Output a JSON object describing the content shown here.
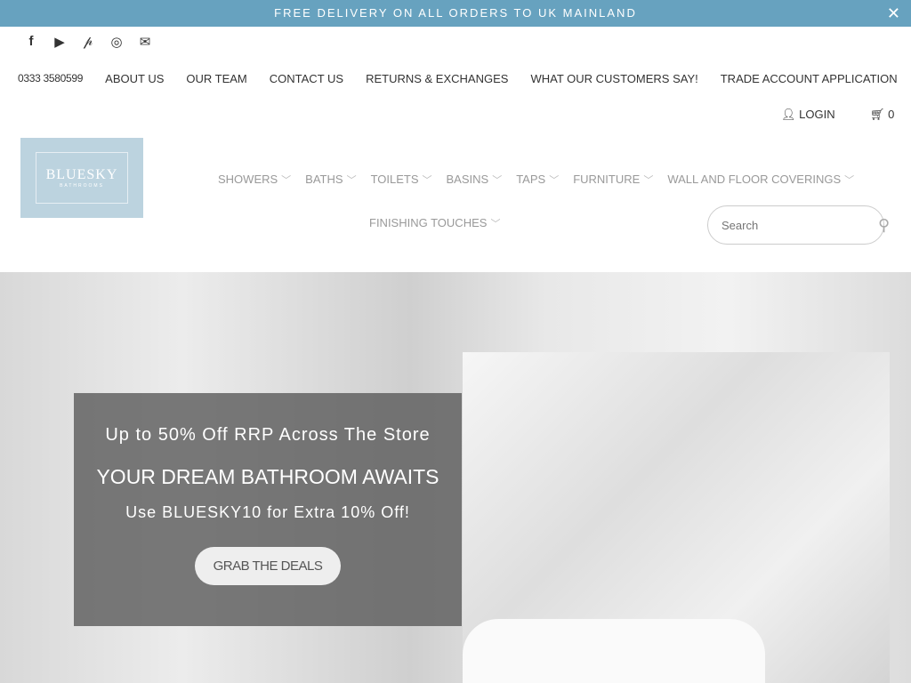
{
  "promo": {
    "text": "FREE DELIVERY ON ALL ORDERS TO UK MAINLAND",
    "close": "✕"
  },
  "social": [
    "facebook-icon",
    "youtube-icon",
    "pinterest-icon",
    "instagram-icon",
    "email-icon"
  ],
  "topnav": {
    "phone": "0333 3580599",
    "items": [
      "ABOUT US",
      "OUR TEAM",
      "CONTACT US",
      "RETURNS & EXCHANGES",
      "WHAT OUR CUSTOMERS SAY!",
      "TRADE ACCOUNT APPLICATION"
    ]
  },
  "account": {
    "login": "LOGIN",
    "cart_count": "0"
  },
  "logo": {
    "name": "BLUESKY",
    "sub": "BATHROOMS"
  },
  "mainnav": [
    "SHOWERS",
    "BATHS",
    "TOILETS",
    "BASINS",
    "TAPS",
    "FURNITURE",
    "WALL AND FLOOR COVERINGS",
    "FINISHING TOUCHES"
  ],
  "search": {
    "placeholder": "Search"
  },
  "hero": {
    "line1": "Up to 50% Off RRP Across The Store",
    "line2": "YOUR DREAM BATHROOM AWAITS",
    "line3": "Use BLUESKY10 for Extra 10% Off!",
    "button": "GRAB THE DEALS"
  },
  "colors": {
    "promo_bar": "#67a2bf",
    "logo_bg": "#bcd3df"
  }
}
